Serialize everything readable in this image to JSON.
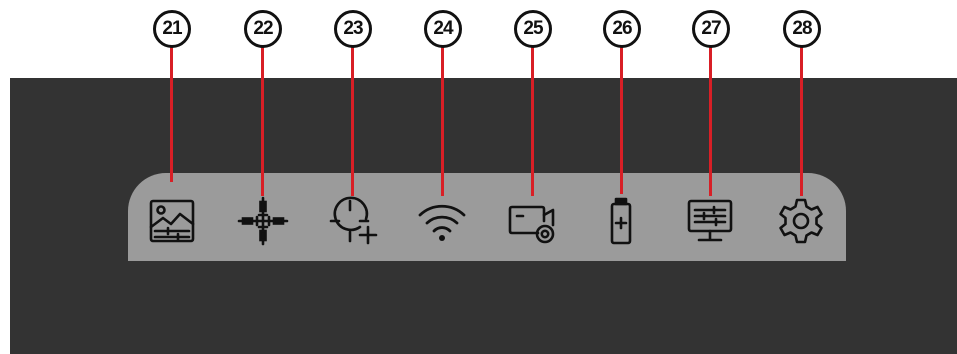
{
  "callouts": [
    {
      "number": "21",
      "icon": "image-adjust-icon"
    },
    {
      "number": "22",
      "icon": "reticle-icon"
    },
    {
      "number": "23",
      "icon": "zeroing-icon"
    },
    {
      "number": "24",
      "icon": "wifi-icon"
    },
    {
      "number": "25",
      "icon": "recording-icon"
    },
    {
      "number": "26",
      "icon": "battery-icon"
    },
    {
      "number": "27",
      "icon": "display-settings-icon"
    },
    {
      "number": "28",
      "icon": "gear-icon"
    }
  ],
  "colors": {
    "panel": "#333333",
    "toolbar": "#9b9b9b",
    "icon_stroke": "#111111",
    "leader_line": "#d81f26",
    "page_background": "#ffffff"
  }
}
